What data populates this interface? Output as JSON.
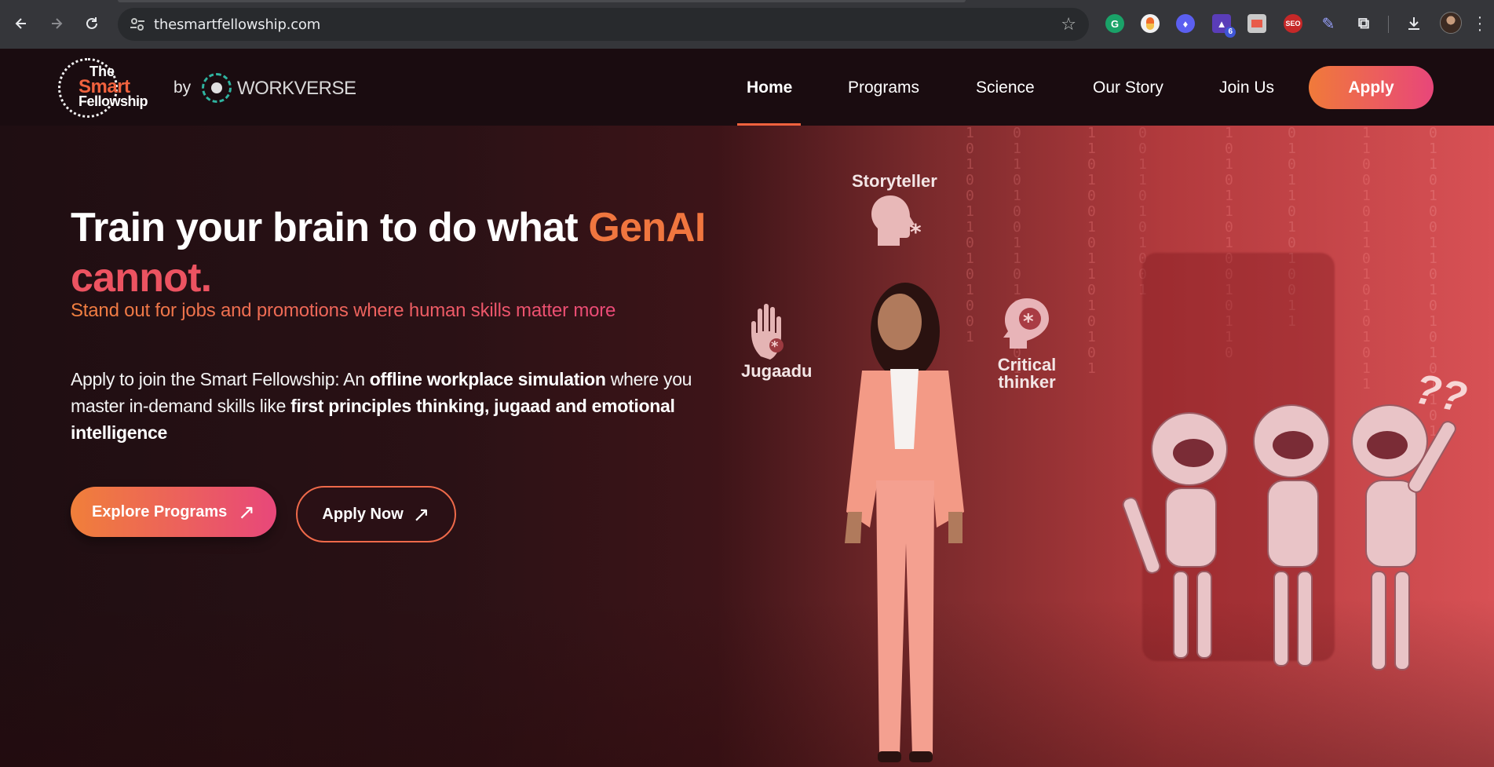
{
  "browser": {
    "url": "thesmartfellowship.com",
    "extension_badge": "6"
  },
  "site": {
    "logo": {
      "line1": "The",
      "line2": "Smart",
      "line3": "Fellowship"
    },
    "by": "by",
    "partner": "WORKVERSE",
    "nav": [
      "Home",
      "Programs",
      "Science",
      "Our Story",
      "Join Us"
    ],
    "active_nav": "Home",
    "apply": "Apply"
  },
  "hero": {
    "headline_a": "Train your brain to do what ",
    "headline_b": "GenAI",
    "headline_c": "cannot.",
    "subhead": "Stand out for jobs and promotions where human skills matter more",
    "desc_1": "Apply to join the Smart Fellowship: An ",
    "desc_b1": "offline workplace simulation",
    "desc_2": " where you master in-demand skills like ",
    "desc_b2": "first principles thinking, jugaad and emotional intelligence",
    "btn_explore": "Explore Programs",
    "btn_apply": "Apply Now"
  },
  "illustration": {
    "skill_1": "Storyteller",
    "skill_2": "Jugaadu",
    "skill_3_line1": "Critical",
    "skill_3_line2": "thinker",
    "robot_text": "??"
  },
  "colors": {
    "brand_orange": "#f0623e",
    "brand_pink": "#e8467a",
    "header_bg": "#1a0c10"
  }
}
